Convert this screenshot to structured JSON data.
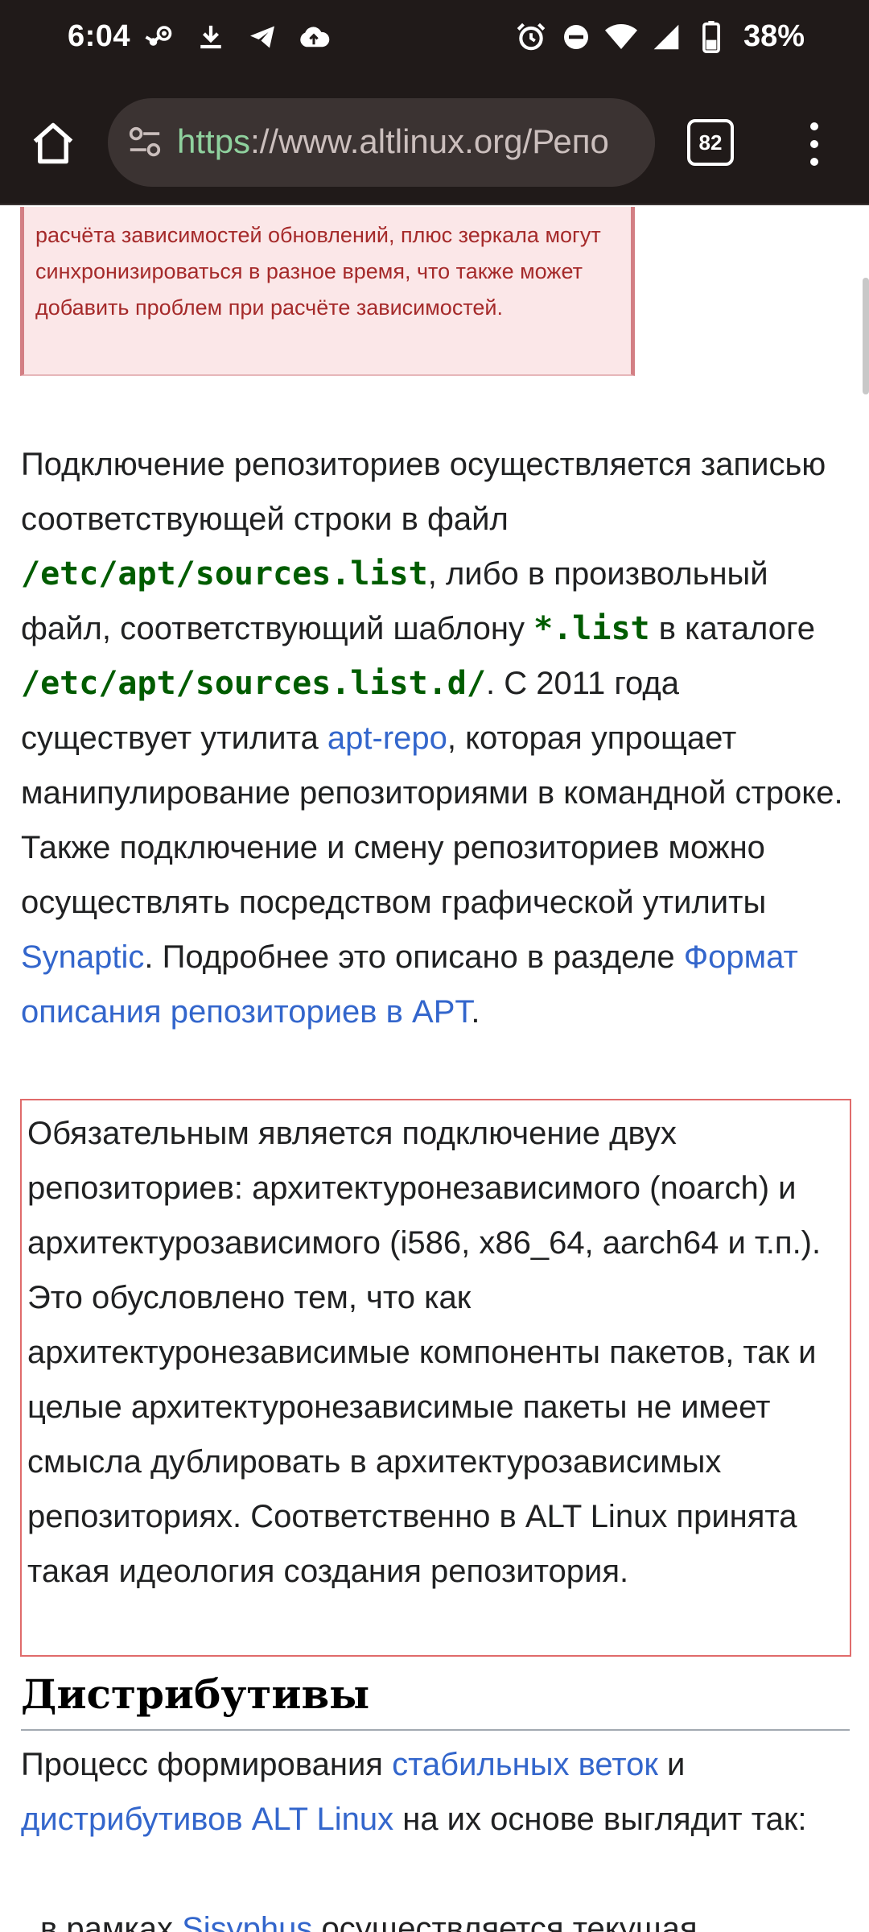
{
  "status_bar": {
    "time": "6:04",
    "battery_percent": "38%"
  },
  "browser": {
    "url_scheme": "https",
    "url_rest": "://www.altlinux.org/Репо",
    "tab_count": "82"
  },
  "article": {
    "warning_text": "расчёта зависимостей обновлений, плюс зеркала могут синхронизироваться в разное время, что также может добавить проблем при расчёте зависимостей.",
    "para1": {
      "t1": "Подключение репозиториев осуществляется записью соответствующей строки в файл ",
      "code1": "/etc/apt/sources.list",
      "t2": ", либо в произвольный файл, соответствующий шаблону ",
      "code2": "*.list",
      "t3": " в каталоге ",
      "code3": "/etc/apt/sources.list.d/",
      "t4": ". С 2011 года существует утилита ",
      "link1": "apt-repo",
      "t5": ", которая упрощает манипулирование репозиториями в командной строке. Также подключение и смену репозиториев можно осуществлять посредством графической утилиты ",
      "link2": "Synaptic",
      "t6": ". Подробнее это описано в разделе ",
      "link3": "Формат описания репозиториев в APT",
      "t7": "."
    },
    "note_text": "Обязательным является подключение двух репозиториев: архитектуронезависимого (noarch) и архитектурозависимого (i586, x86_64, aarch64 и т.п.). Это обусловлено тем, что как архитектуронезависимые компоненты пакетов, так и целые архитектуронезависимые пакеты не имеет смысла дублировать в архитектурозависимых репозиториях. Соответственно в ALT Linux принята такая идеология создания репозитория.",
    "section_heading": "Дистрибутивы",
    "para2": {
      "t1": "Процесс формирования ",
      "link1": "стабильных веток",
      "t2": " и ",
      "link2": "дистрибутивов ALT Linux",
      "t3": " на их основе выглядит так:"
    },
    "list_item": {
      "t1": "в рамках ",
      "link1": "Sisyphus",
      "t2": " осуществляется текущая"
    }
  },
  "icons": {
    "status": [
      "steam-icon",
      "download-icon",
      "telegram-icon",
      "cloud-upload-icon",
      "alarm-icon",
      "do-not-disturb-icon",
      "wifi-icon",
      "cell-signal-icon",
      "battery-icon"
    ],
    "toolbar": [
      "home-icon",
      "site-settings-icon",
      "tab-switcher-icon",
      "more-menu-icon"
    ]
  },
  "colors": {
    "chrome_bg": "#201a19",
    "url_scheme": "#8fd19e",
    "link": "#3366cc",
    "code": "#005c00",
    "warning_text": "#a52a2a",
    "warning_bg": "#fbe7e8",
    "note_border": "#e06b6b"
  }
}
